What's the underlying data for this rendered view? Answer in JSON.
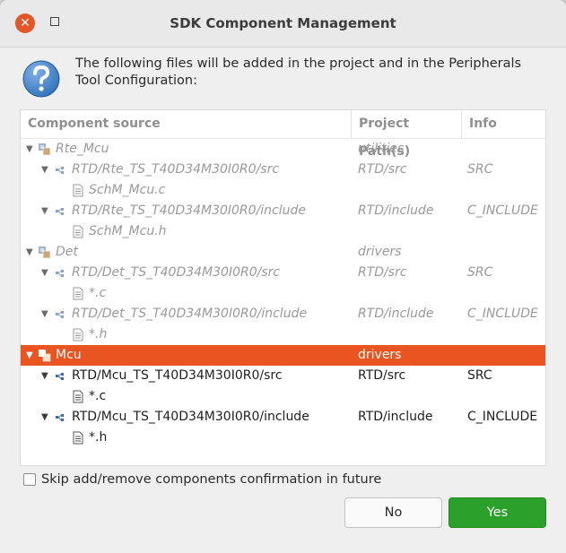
{
  "dialog": {
    "title": "SDK Component Management",
    "message": "The following files will be added in the project and in the Peripherals Tool Configuration:",
    "close_glyph": "✕",
    "icons": {
      "close": "close-icon",
      "minimize": "minimize-icon",
      "question": "question-icon"
    }
  },
  "table": {
    "columns": [
      "Component source",
      "Project Path(s)",
      "Info"
    ],
    "rows": [
      {
        "level": 0,
        "expander": "▼",
        "icon": "component-icon",
        "name": "Rte_Mcu",
        "path": "utilities",
        "info": "",
        "state": "disabled"
      },
      {
        "level": 1,
        "expander": "▼",
        "icon": "folder-node-icon",
        "name": "RTD/Rte_TS_T40D34M30I0R0/src",
        "path": "RTD/src",
        "info": "SRC",
        "state": "disabled"
      },
      {
        "level": 2,
        "expander": "",
        "icon": "file-icon",
        "name": "SchM_Mcu.c",
        "path": "",
        "info": "",
        "state": "disabled"
      },
      {
        "level": 1,
        "expander": "▼",
        "icon": "folder-node-icon",
        "name": "RTD/Rte_TS_T40D34M30I0R0/include",
        "path": "RTD/include",
        "info": "C_INCLUDE",
        "state": "disabled"
      },
      {
        "level": 2,
        "expander": "",
        "icon": "file-icon",
        "name": "SchM_Mcu.h",
        "path": "",
        "info": "",
        "state": "disabled"
      },
      {
        "level": 0,
        "expander": "▼",
        "icon": "component-icon",
        "name": "Det",
        "path": "drivers",
        "info": "",
        "state": "disabled"
      },
      {
        "level": 1,
        "expander": "▼",
        "icon": "folder-node-icon",
        "name": "RTD/Det_TS_T40D34M30I0R0/src",
        "path": "RTD/src",
        "info": "SRC",
        "state": "disabled"
      },
      {
        "level": 2,
        "expander": "",
        "icon": "file-icon",
        "name": "*.c",
        "path": "",
        "info": "",
        "state": "disabled"
      },
      {
        "level": 1,
        "expander": "▼",
        "icon": "folder-node-icon",
        "name": "RTD/Det_TS_T40D34M30I0R0/include",
        "path": "RTD/include",
        "info": "C_INCLUDE",
        "state": "disabled"
      },
      {
        "level": 2,
        "expander": "",
        "icon": "file-icon",
        "name": "*.h",
        "path": "",
        "info": "",
        "state": "disabled"
      },
      {
        "level": 0,
        "expander": "▼",
        "icon": "component-icon",
        "name": "Mcu",
        "path": "drivers",
        "info": "",
        "state": "selected"
      },
      {
        "level": 1,
        "expander": "▼",
        "icon": "folder-node-icon",
        "name": "RTD/Mcu_TS_T40D34M30I0R0/src",
        "path": "RTD/src",
        "info": "SRC",
        "state": "normal"
      },
      {
        "level": 2,
        "expander": "",
        "icon": "file-icon",
        "name": "*.c",
        "path": "",
        "info": "",
        "state": "normal"
      },
      {
        "level": 1,
        "expander": "▼",
        "icon": "folder-node-icon",
        "name": "RTD/Mcu_TS_T40D34M30I0R0/include",
        "path": "RTD/include",
        "info": "C_INCLUDE",
        "state": "normal"
      },
      {
        "level": 2,
        "expander": "",
        "icon": "file-icon",
        "name": "*.h",
        "path": "",
        "info": "",
        "state": "normal"
      }
    ]
  },
  "checkbox": {
    "label": "Skip add/remove components confirmation in future",
    "checked": false
  },
  "buttons": {
    "no": "No",
    "yes": "Yes"
  },
  "colors": {
    "selection": "#e95420",
    "yes_button": "#2ba02b",
    "close_button": "#e2562a",
    "question_icon": "#2e6fb8"
  }
}
